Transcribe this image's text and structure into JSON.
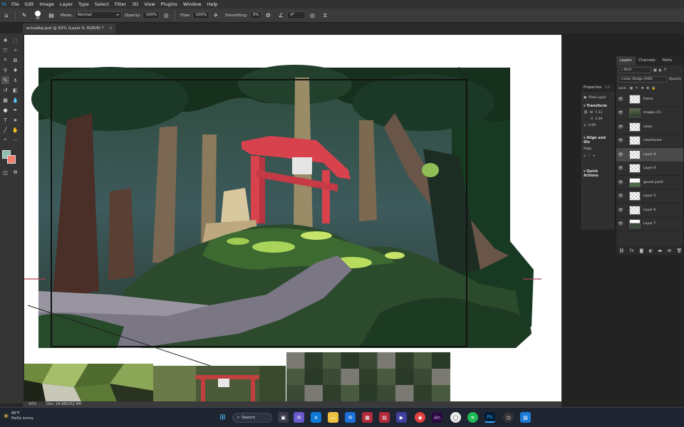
{
  "app": {
    "menu": [
      "File",
      "Edit",
      "Image",
      "Layer",
      "Type",
      "Select",
      "Filter",
      "3D",
      "View",
      "Plugins",
      "Window",
      "Help"
    ],
    "ps_logo": "Ps"
  },
  "options": {
    "mode_label": "Mode:",
    "mode_value": "Normal",
    "opacity_label": "Opacity:",
    "opacity_value": "100%",
    "flow_label": "Flow:",
    "flow_value": "100%",
    "smoothing_label": "Smoothing:",
    "smoothing_value": "0%",
    "angle_value": "0°",
    "brush_size": "60"
  },
  "document": {
    "tab_title": "actualbg.psd @ 50% (Layer 9, RGB/8) *",
    "tab_close": "×"
  },
  "status": {
    "zoom": "50%",
    "doc_info": "Doc: 24.9M/352.4M"
  },
  "properties": {
    "tabs": [
      "Properties",
      "Inf"
    ],
    "pixel_layer": "Pixel Layer",
    "transform": "Transform",
    "w_label": "W",
    "w_value": "7.22",
    "h_label": "H",
    "h_value": "4.39",
    "angle_value": "0.00",
    "align": "Align and Dis",
    "align_sub": "Align:",
    "quick_actions": "Quick Actions"
  },
  "layers_panel": {
    "tabs": [
      "Layers",
      "Channels",
      "Paths"
    ],
    "filter_kind": "Kind",
    "blend_mode": "Linear Dodge (Add)",
    "opacity_label": "Opacity",
    "lock_label": "Lock:",
    "layers": [
      {
        "name": "frame",
        "selected": false
      },
      {
        "name": "images (1)",
        "selected": false
      },
      {
        "name": "clean",
        "selected": false
      },
      {
        "name": "cleanforest",
        "selected": false
      },
      {
        "name": "Layer 9",
        "selected": true
      },
      {
        "name": "Layer 8",
        "selected": false
      },
      {
        "name": "gound paint",
        "selected": false
      },
      {
        "name": "Layer 5",
        "selected": false
      },
      {
        "name": "Layer 6",
        "selected": false
      },
      {
        "name": "Layer 7",
        "selected": false
      }
    ]
  },
  "taskbar": {
    "weather_temp": "89°F",
    "weather_desc": "Partly sunny",
    "search_label": "Search"
  },
  "colors": {
    "foreground": "#8fbfae",
    "background": "#f08070",
    "torii": "#d7424c",
    "ps_blue": "#31a8ff"
  }
}
